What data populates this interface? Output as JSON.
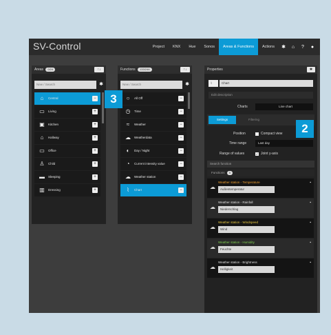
{
  "app": {
    "title": "SV-Control",
    "menu": [
      "Project",
      "KNX",
      "Hue",
      "Sonos",
      "Areas & Functions",
      "Actions"
    ],
    "active_menu": "Areas & Functions",
    "icons": [
      "gear-icon",
      "home-icon",
      "help-icon",
      "user-icon"
    ]
  },
  "areas": {
    "title": "Areas",
    "badge": "0/24",
    "search_placeholder": "New / Search",
    "items": [
      {
        "label": "Central",
        "icon": "house-icon",
        "selected": true
      },
      {
        "label": "Living",
        "icon": "sofa-icon"
      },
      {
        "label": "Kitchen",
        "icon": "stove-icon"
      },
      {
        "label": "Hallway",
        "icon": "door-icon"
      },
      {
        "label": "Office",
        "icon": "monitor-icon"
      },
      {
        "label": "Child",
        "icon": "child-icon"
      },
      {
        "label": "Sleeping",
        "icon": "bed-icon"
      },
      {
        "label": "Dressing",
        "icon": "wardrobe-icon"
      }
    ]
  },
  "functions": {
    "title": "Functions",
    "badge": "133/246",
    "search_placeholder": "New / Search",
    "items": [
      {
        "label": "All Off",
        "icon": "power-icon"
      },
      {
        "label": "Time",
        "icon": "clock-icon"
      },
      {
        "label": "Weather",
        "icon": "wind-icon"
      },
      {
        "label": "Weatherdata",
        "icon": "weather-icon"
      },
      {
        "label": "Day / Night",
        "icon": "moon-icon"
      },
      {
        "label": "Current intensity value",
        "icon": "dimmer-icon"
      },
      {
        "label": "Weather station",
        "icon": "weather-icon"
      },
      {
        "label": "Chart",
        "icon": "chart-icon",
        "selected": true
      }
    ]
  },
  "properties": {
    "title": "Properties",
    "name_value": "Chart",
    "description_placeholder": "Edit description",
    "charts_label": "Charts",
    "charts_value": "Line chart",
    "tabs": [
      "Settings",
      "Filtering"
    ],
    "position_label": "Position",
    "compact_label": "Compact view",
    "time_range_label": "Time range",
    "time_range_value": "Last day",
    "range_label": "Range of values",
    "joint_label": "Joint y-axis",
    "search_function_placeholder": "Search function",
    "functions_label": "Functions",
    "functions_count": "5",
    "fn_items": [
      {
        "title": "Weather station - Temperature",
        "value": "Außentemperatur",
        "color": "#f0a030"
      },
      {
        "title": "Weather station - Rainfall",
        "value": "Niederschlag",
        "color": "#e0e0e0"
      },
      {
        "title": "Weather station - Windspeed",
        "value": "Wind",
        "color": "#e8c840"
      },
      {
        "title": "Weather station - Humidity",
        "value": "Feuchte",
        "color": "#7fd050"
      },
      {
        "title": "Weather station - Brightness",
        "value": "Helligkeit",
        "color": "#e0e0e0"
      }
    ]
  },
  "callouts": {
    "one": "3",
    "two": "2"
  },
  "colors": {
    "accent": "#0c9bd6",
    "background": "#c9dbe6"
  }
}
